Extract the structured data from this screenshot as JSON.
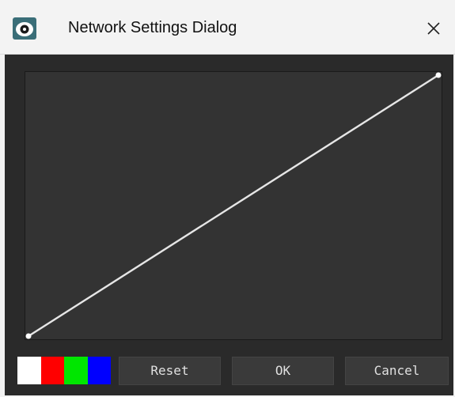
{
  "window": {
    "title": "Network Settings Dialog",
    "app_icon": "eye-logo-icon",
    "close_icon": "close-icon",
    "accent_color": "#3a6e78"
  },
  "curve": {
    "type": "line",
    "x": [
      0,
      1
    ],
    "y": [
      0,
      1
    ],
    "control_points": [
      {
        "x": 0,
        "y": 0
      },
      {
        "x": 1,
        "y": 1
      }
    ],
    "line_color": "#e6e6e6",
    "background_color": "#333333"
  },
  "channels": [
    {
      "name": "white",
      "color": "#ffffff"
    },
    {
      "name": "red",
      "color": "#ff0000"
    },
    {
      "name": "green",
      "color": "#00e600"
    },
    {
      "name": "blue",
      "color": "#0000ff"
    }
  ],
  "buttons": {
    "reset_label": "Reset",
    "ok_label": "OK",
    "cancel_label": "Cancel"
  }
}
